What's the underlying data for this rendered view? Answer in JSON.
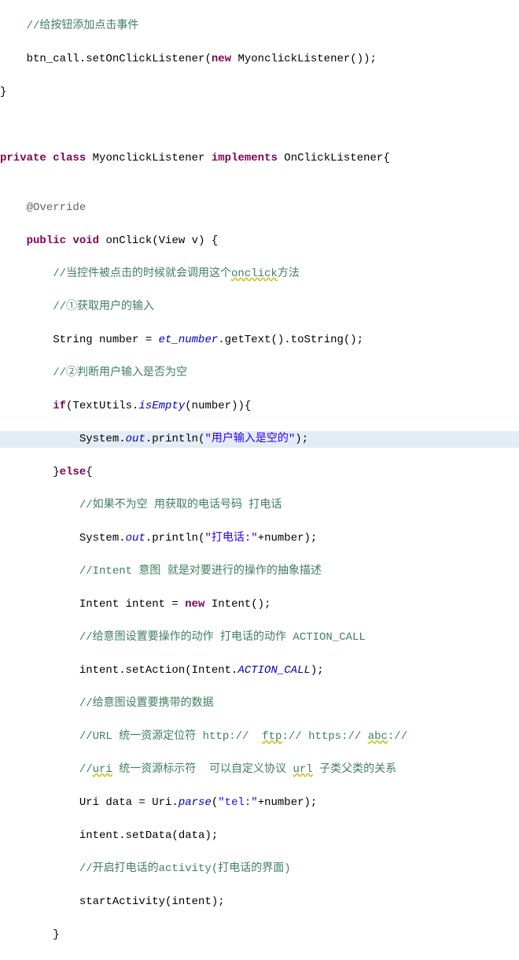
{
  "code": {
    "l1": "    //给按钮添加点击事件",
    "l2a": "    btn_call.setOnClickListener(",
    "l2b": "new",
    "l2c": " MyonclickListener());",
    "l3": "}",
    "l4": "",
    "l5": "",
    "l6a": "private",
    "l6b": " ",
    "l6c": "class",
    "l6d": " MyonclickListener ",
    "l6e": "implements",
    "l6f": " OnClickListener{",
    "l7": "",
    "l8a": "    ",
    "l8b": "@Override",
    "l9a": "    ",
    "l9b": "public",
    "l9c": " ",
    "l9d": "void",
    "l9e": " onClick(View v) {",
    "l10a": "        //当控件被点击的时候就会调用这个",
    "l10b": "onclick",
    "l10c": "方法",
    "l11": "        //①获取用户的输入",
    "l12a": "        String number = ",
    "l12b": "et_number",
    "l12c": ".getText().toString();",
    "l13": "        //②判断用户输入是否为空",
    "l14a": "        ",
    "l14b": "if",
    "l14c": "(TextUtils.",
    "l14d": "isEmpty",
    "l14e": "(number)){",
    "l15a": "            System.",
    "l15b": "out",
    "l15c": ".println(",
    "l15d": "\"用户输入是空的\"",
    "l15e": ");",
    "l16a": "        }",
    "l16b": "else",
    "l16c": "{",
    "l17": "            //如果不为空 用获取的电话号码 打电话",
    "l18a": "            System.",
    "l18b": "out",
    "l18c": ".println(",
    "l18d": "\"打电话:\"",
    "l18e": "+number);",
    "l19": "            //Intent 意图 就是对要进行的操作的抽象描述",
    "l20a": "            Intent intent = ",
    "l20b": "new",
    "l20c": " Intent();",
    "l21": "            //给意图设置要操作的动作 打电话的动作 ACTION_CALL",
    "l22a": "            intent.setAction(Intent.",
    "l22b": "ACTION_CALL",
    "l22c": ");",
    "l23": "            //给意图设置要携带的数据",
    "l24a": "            //URL 统一资源定位符 http://  ",
    "l24b": "ftp",
    "l24c": ":// https:// ",
    "l24d": "abc",
    "l24e": "://",
    "l25a": "            //",
    "l25b": "uri",
    "l25c": " 统一资源标示符  可以自定义协议 ",
    "l25d": "url",
    "l25e": " 子类父类的关系",
    "l26a": "            Uri data = Uri.",
    "l26b": "parse",
    "l26c": "(",
    "l26d": "\"tel:\"",
    "l26e": "+number);",
    "l27": "            intent.setData(data);",
    "l28": "            //开启打电话的activity(打电话的界面)",
    "l29": "            startActivity(intent);",
    "l30": "        }"
  }
}
